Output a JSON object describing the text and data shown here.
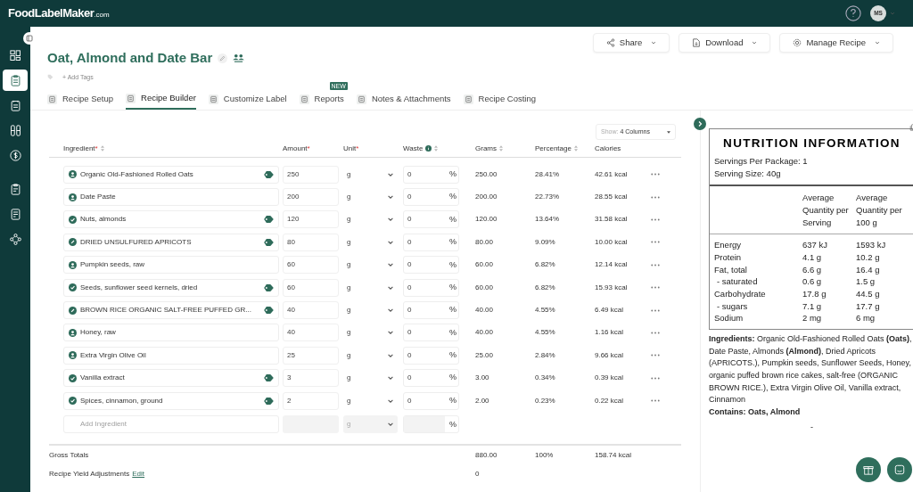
{
  "app": {
    "logo": "FoodLabelMaker",
    "logo_suffix": ".com",
    "avatar": "MS"
  },
  "sidebar": {
    "items": [
      {
        "kind": "dashboard",
        "selected": false
      },
      {
        "kind": "recipe",
        "selected": true
      },
      {
        "kind": "list",
        "selected": false
      },
      {
        "kind": "columns",
        "selected": false
      },
      {
        "kind": "money",
        "selected": false
      },
      {
        "kind": "clipboard",
        "selected": false
      },
      {
        "kind": "report",
        "selected": false
      },
      {
        "kind": "network",
        "selected": false
      }
    ]
  },
  "recipe": {
    "title": "Oat, Almond and Date Bar",
    "add_tags": "+ Add Tags"
  },
  "actions": [
    {
      "kind": "share",
      "label": "Share"
    },
    {
      "kind": "download",
      "label": "Download"
    },
    {
      "kind": "settings",
      "label": "Manage Recipe"
    }
  ],
  "tabs": [
    {
      "label": "Recipe Setup",
      "selected": false
    },
    {
      "label": "Recipe Builder",
      "selected": true
    },
    {
      "label": "Customize Label",
      "selected": false
    },
    {
      "label": "Reports",
      "selected": false,
      "badge": "NEW"
    },
    {
      "label": "Notes & Attachments",
      "selected": false
    },
    {
      "label": "Recipe Costing",
      "selected": false
    }
  ],
  "columns_select": {
    "prefix": "Show:",
    "value": "4 Columns"
  },
  "table": {
    "columns": [
      {
        "label": "Ingredient",
        "required_mark": "*",
        "sortable": true
      },
      {
        "label": "Amount",
        "required_mark": "*",
        "sortable": false
      },
      {
        "label": "Unit",
        "required_mark": "*",
        "sortable": false
      },
      {
        "label": "Waste",
        "info": true,
        "sortable": true
      },
      {
        "label": "Grams",
        "sortable": true
      },
      {
        "label": "Percentage",
        "sortable": true
      },
      {
        "label": "Calories",
        "sortable": false
      }
    ],
    "rows": [
      {
        "kind": "user",
        "ingredient": "Organic Old-Fashioned Rolled Oats",
        "tagged": true,
        "amount": "250",
        "unit": "g",
        "waste": "0",
        "waste_unit": "%",
        "grams": "250.00",
        "percentage": "28.41%",
        "calories": "42.61 kcal"
      },
      {
        "kind": "user",
        "ingredient": "Date Paste",
        "tagged": false,
        "amount": "200",
        "unit": "g",
        "waste": "0",
        "waste_unit": "%",
        "grams": "200.00",
        "percentage": "22.73%",
        "calories": "28.55 kcal"
      },
      {
        "kind": "verified",
        "ingredient": "Nuts, almonds",
        "tagged": true,
        "amount": "120",
        "unit": "g",
        "waste": "0",
        "waste_unit": "%",
        "grams": "120.00",
        "percentage": "13.64%",
        "calories": "31.58 kcal"
      },
      {
        "kind": "brand",
        "ingredient": "DRIED UNSULFURED APRICOTS",
        "tagged": true,
        "amount": "80",
        "unit": "g",
        "waste": "0",
        "waste_unit": "%",
        "grams": "80.00",
        "percentage": "9.09%",
        "calories": "10.00 kcal"
      },
      {
        "kind": "user",
        "ingredient": "Pumpkin seeds, raw",
        "tagged": false,
        "amount": "60",
        "unit": "g",
        "waste": "0",
        "waste_unit": "%",
        "grams": "60.00",
        "percentage": "6.82%",
        "calories": "12.14 kcal"
      },
      {
        "kind": "verified",
        "ingredient": "Seeds, sunflower seed kernels, dried",
        "tagged": true,
        "amount": "60",
        "unit": "g",
        "waste": "0",
        "waste_unit": "%",
        "grams": "60.00",
        "percentage": "6.82%",
        "calories": "15.93 kcal"
      },
      {
        "kind": "brand",
        "ingredient": "BROWN RICE ORGANIC SALT-FREE PUFFED GR...",
        "tagged": true,
        "amount": "40",
        "unit": "g",
        "waste": "0",
        "waste_unit": "%",
        "grams": "40.00",
        "percentage": "4.55%",
        "calories": "6.49 kcal"
      },
      {
        "kind": "user",
        "ingredient": "Honey, raw",
        "tagged": false,
        "amount": "40",
        "unit": "g",
        "waste": "0",
        "waste_unit": "%",
        "grams": "40.00",
        "percentage": "4.55%",
        "calories": "1.16 kcal"
      },
      {
        "kind": "user",
        "ingredient": "Extra Virgin Olive Oil",
        "tagged": false,
        "amount": "25",
        "unit": "g",
        "waste": "0",
        "waste_unit": "%",
        "grams": "25.00",
        "percentage": "2.84%",
        "calories": "9.66 kcal"
      },
      {
        "kind": "verified",
        "ingredient": "Vanilla extract",
        "tagged": true,
        "amount": "3",
        "unit": "g",
        "waste": "0",
        "waste_unit": "%",
        "grams": "3.00",
        "percentage": "0.34%",
        "calories": "0.39 kcal"
      },
      {
        "kind": "verified",
        "ingredient": "Spices, cinnamon, ground",
        "tagged": true,
        "amount": "2",
        "unit": "g",
        "waste": "0",
        "waste_unit": "%",
        "grams": "2.00",
        "percentage": "0.23%",
        "calories": "0.22 kcal"
      }
    ],
    "add_row": {
      "placeholder": "Add Ingredient",
      "unit": "g",
      "waste_unit": "%"
    },
    "totals": {
      "label": "Gross Totals",
      "grams": "880.00",
      "percentage": "100%",
      "calories": "158.74 kcal"
    },
    "yield": {
      "label": "Recipe Yield Adjustments",
      "link": "Edit",
      "grams": "0"
    }
  },
  "nutrition": {
    "title": "NUTRITION INFORMATION",
    "servings": [
      "Servings Per Package: 1",
      "Serving Size: 40g"
    ],
    "headers": [
      "Average Quantity per Serving",
      "Average Quantity per 100 g"
    ],
    "rows": [
      {
        "name": "Energy",
        "sub": false,
        "per_serving": "637 kJ",
        "per_100g": "1593 kJ"
      },
      {
        "name": "Protein",
        "sub": false,
        "per_serving": "4.1 g",
        "per_100g": "10.2 g"
      },
      {
        "name": "Fat, total",
        "sub": false,
        "per_serving": "6.6 g",
        "per_100g": "16.4 g"
      },
      {
        "name": "- saturated",
        "sub": true,
        "per_serving": "0.6 g",
        "per_100g": "1.5 g"
      },
      {
        "name": "Carbohydrate",
        "sub": false,
        "per_serving": "17.8 g",
        "per_100g": "44.5 g"
      },
      {
        "name": "- sugars",
        "sub": true,
        "per_serving": "7.1 g",
        "per_100g": "17.7 g"
      },
      {
        "name": "Sodium",
        "sub": false,
        "per_serving": "2 mg",
        "per_100g": "6 mg"
      }
    ],
    "ingredients": "**Ingredients:** Organic Old-Fashioned Rolled Oats **(Oats)**, Date Paste, Almonds **(Almond)**, Dried Apricots (APRICOTS.), Pumpkin seeds, Sunflower Seeds, Honey, organic puffed brown rice cakes, salt-free (ORGANIC BROWN RICE.), Extra Virgin Olive Oil, Vanilla extract, Cinnamon",
    "contains": "Contains: Oats, Almond",
    "footer": "-"
  }
}
